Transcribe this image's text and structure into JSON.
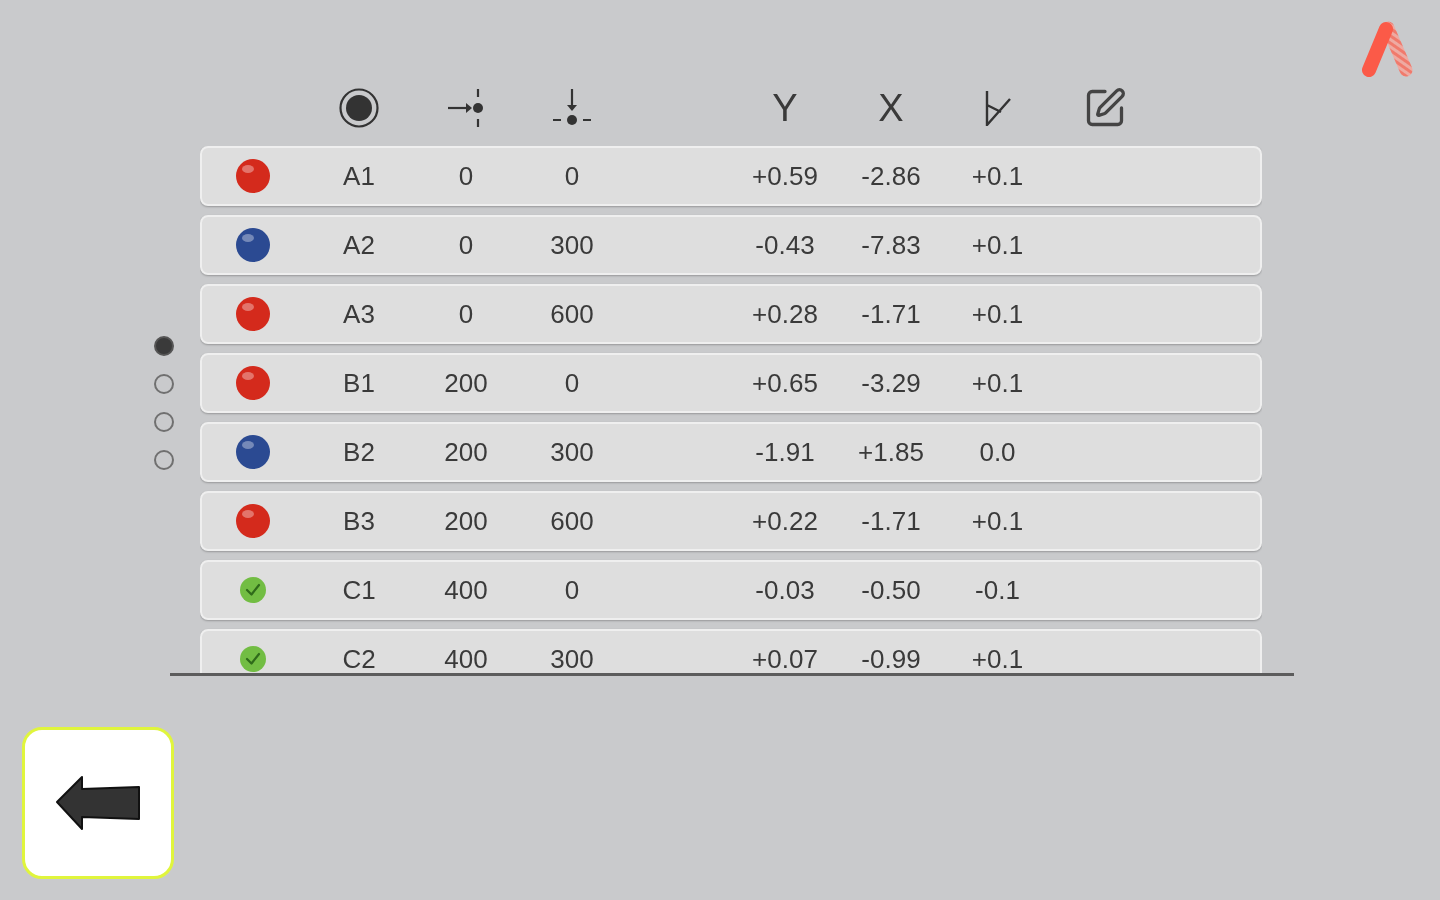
{
  "table": {
    "header_labels": [
      "Y",
      "X"
    ],
    "rows": [
      {
        "kind": "ball",
        "color": "#d42a1c",
        "cells": [
          "A1",
          "0",
          "0",
          "+0.59",
          "-2.86",
          "+0.1"
        ]
      },
      {
        "kind": "ball",
        "color": "#2b4a92",
        "cells": [
          "A2",
          "0",
          "300",
          "-0.43",
          "-7.83",
          "+0.1"
        ]
      },
      {
        "kind": "ball",
        "color": "#d42a1c",
        "cells": [
          "A3",
          "0",
          "600",
          "+0.28",
          "-1.71",
          "+0.1"
        ]
      },
      {
        "kind": "ball",
        "color": "#d42a1c",
        "cells": [
          "B1",
          "200",
          "0",
          "+0.65",
          "-3.29",
          "+0.1"
        ]
      },
      {
        "kind": "ball",
        "color": "#2b4a92",
        "cells": [
          "B2",
          "200",
          "300",
          "-1.91",
          "+1.85",
          "0.0"
        ]
      },
      {
        "kind": "ball",
        "color": "#d42a1c",
        "cells": [
          "B3",
          "200",
          "600",
          "+0.22",
          "-1.71",
          "+0.1"
        ]
      },
      {
        "kind": "check",
        "color": "#72bd43",
        "cells": [
          "C1",
          "400",
          "0",
          "-0.03",
          "-0.50",
          "-0.1"
        ]
      },
      {
        "kind": "check",
        "color": "#72bd43",
        "cells": [
          "C2",
          "400",
          "300",
          "+0.07",
          "-0.99",
          "+0.1"
        ]
      }
    ]
  },
  "pages": [
    {
      "selected": true
    },
    {
      "selected": false
    },
    {
      "selected": false
    },
    {
      "selected": false
    }
  ]
}
